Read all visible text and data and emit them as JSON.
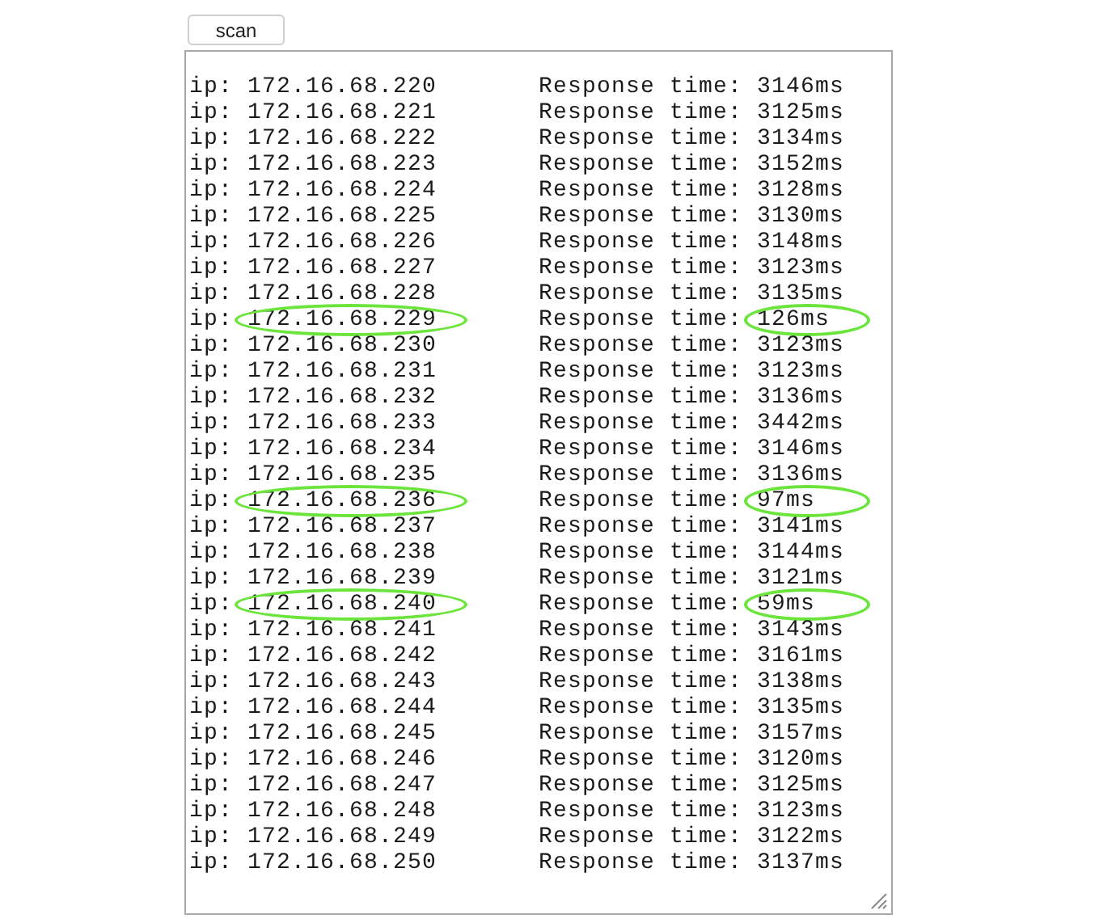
{
  "scan_button": {
    "label": "scan"
  },
  "output": {
    "rows": [
      {
        "ip": "ip: 172.16.68.220",
        "response": "Response time: 3146ms",
        "circled": false
      },
      {
        "ip": "ip: 172.16.68.221",
        "response": "Response time: 3125ms",
        "circled": false
      },
      {
        "ip": "ip: 172.16.68.222",
        "response": "Response time: 3134ms",
        "circled": false
      },
      {
        "ip": "ip: 172.16.68.223",
        "response": "Response time: 3152ms",
        "circled": false
      },
      {
        "ip": "ip: 172.16.68.224",
        "response": "Response time: 3128ms",
        "circled": false
      },
      {
        "ip": "ip: 172.16.68.225",
        "response": "Response time: 3130ms",
        "circled": false
      },
      {
        "ip": "ip: 172.16.68.226",
        "response": "Response time: 3148ms",
        "circled": false
      },
      {
        "ip": "ip: 172.16.68.227",
        "response": "Response time: 3123ms",
        "circled": false
      },
      {
        "ip": "ip: 172.16.68.228",
        "response": "Response time: 3135ms",
        "circled": false
      },
      {
        "ip": "ip: 172.16.68.229",
        "response": "Response time: 126ms",
        "circled": true
      },
      {
        "ip": "ip: 172.16.68.230",
        "response": "Response time: 3123ms",
        "circled": false
      },
      {
        "ip": "ip: 172.16.68.231",
        "response": "Response time: 3123ms",
        "circled": false
      },
      {
        "ip": "ip: 172.16.68.232",
        "response": "Response time: 3136ms",
        "circled": false
      },
      {
        "ip": "ip: 172.16.68.233",
        "response": "Response time: 3442ms",
        "circled": false
      },
      {
        "ip": "ip: 172.16.68.234",
        "response": "Response time: 3146ms",
        "circled": false
      },
      {
        "ip": "ip: 172.16.68.235",
        "response": "Response time: 3136ms",
        "circled": false
      },
      {
        "ip": "ip: 172.16.68.236",
        "response": "Response time: 97ms",
        "circled": true
      },
      {
        "ip": "ip: 172.16.68.237",
        "response": "Response time: 3141ms",
        "circled": false
      },
      {
        "ip": "ip: 172.16.68.238",
        "response": "Response time: 3144ms",
        "circled": false
      },
      {
        "ip": "ip: 172.16.68.239",
        "response": "Response time: 3121ms",
        "circled": false
      },
      {
        "ip": "ip: 172.16.68.240",
        "response": "Response time: 59ms",
        "circled": true
      },
      {
        "ip": "ip: 172.16.68.241",
        "response": "Response time: 3143ms",
        "circled": false
      },
      {
        "ip": "ip: 172.16.68.242",
        "response": "Response time: 3161ms",
        "circled": false
      },
      {
        "ip": "ip: 172.16.68.243",
        "response": "Response time: 3138ms",
        "circled": false
      },
      {
        "ip": "ip: 172.16.68.244",
        "response": "Response time: 3135ms",
        "circled": false
      },
      {
        "ip": "ip: 172.16.68.245",
        "response": "Response time: 3157ms",
        "circled": false
      },
      {
        "ip": "ip: 172.16.68.246",
        "response": "Response time: 3120ms",
        "circled": false
      },
      {
        "ip": "ip: 172.16.68.247",
        "response": "Response time: 3125ms",
        "circled": false
      },
      {
        "ip": "ip: 172.16.68.248",
        "response": "Response time: 3123ms",
        "circled": false
      },
      {
        "ip": "ip: 172.16.68.249",
        "response": "Response time: 3122ms",
        "circled": false
      },
      {
        "ip": "ip: 172.16.68.250",
        "response": "Response time: 3137ms",
        "circled": false
      }
    ]
  }
}
